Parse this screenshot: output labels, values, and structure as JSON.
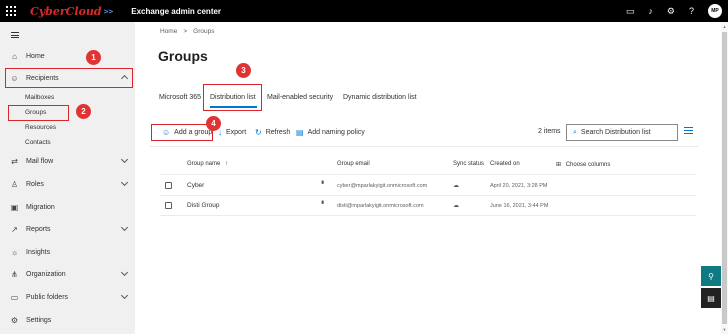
{
  "header": {
    "brand": "CyberCloud",
    "brand_suffix": ">>",
    "app_title": "Exchange admin center",
    "avatar_initials": "MP"
  },
  "sidebar": {
    "items": [
      {
        "label": "Home",
        "icon": "home-icon"
      },
      {
        "label": "Recipients",
        "icon": "person-icon"
      },
      {
        "label": "Mail flow",
        "icon": "mail-flow-icon"
      },
      {
        "label": "Roles",
        "icon": "roles-icon"
      },
      {
        "label": "Migration",
        "icon": "migration-icon"
      },
      {
        "label": "Reports",
        "icon": "reports-icon"
      },
      {
        "label": "Insights",
        "icon": "insights-icon"
      },
      {
        "label": "Organization",
        "icon": "organization-icon"
      },
      {
        "label": "Public folders",
        "icon": "public-folders-icon"
      },
      {
        "label": "Settings",
        "icon": "gear-icon"
      }
    ],
    "recipients_sub": [
      "Mailboxes",
      "Groups",
      "Resources",
      "Contacts"
    ]
  },
  "breadcrumb": {
    "home": "Home",
    "separator": ">",
    "current": "Groups"
  },
  "page": {
    "title": "Groups"
  },
  "tabs": [
    "Microsoft 365",
    "Distribution list",
    "Mail-enabled security",
    "Dynamic distribution list"
  ],
  "commands": {
    "add_group": "Add a group",
    "export": "Export",
    "refresh": "Refresh",
    "add_naming_policy": "Add naming policy",
    "item_count": "2 items",
    "search_placeholder": "Search Distribution list"
  },
  "table": {
    "headers": {
      "group_name": "Group name",
      "sort": "↑",
      "group_email": "Group email",
      "sync_status": "Sync status",
      "created_on": "Created on",
      "choose_columns": "Choose columns"
    },
    "rows": [
      {
        "name": "Cyber",
        "email": "cyber@mparlakyigit.onmicrosoft.com",
        "created": "April 20, 2021, 3:28 PM"
      },
      {
        "name": "Disti Group",
        "email": "disti@mparlakyigit.onmicrosoft.com",
        "created": "June 16, 2021, 3:44 PM"
      }
    ]
  },
  "callouts": [
    "1",
    "2",
    "3",
    "4"
  ],
  "colors": {
    "accent": "#0078d4",
    "callout": "#e03434",
    "brand_red": "#d82a2a",
    "teal": "#0e7a84"
  }
}
